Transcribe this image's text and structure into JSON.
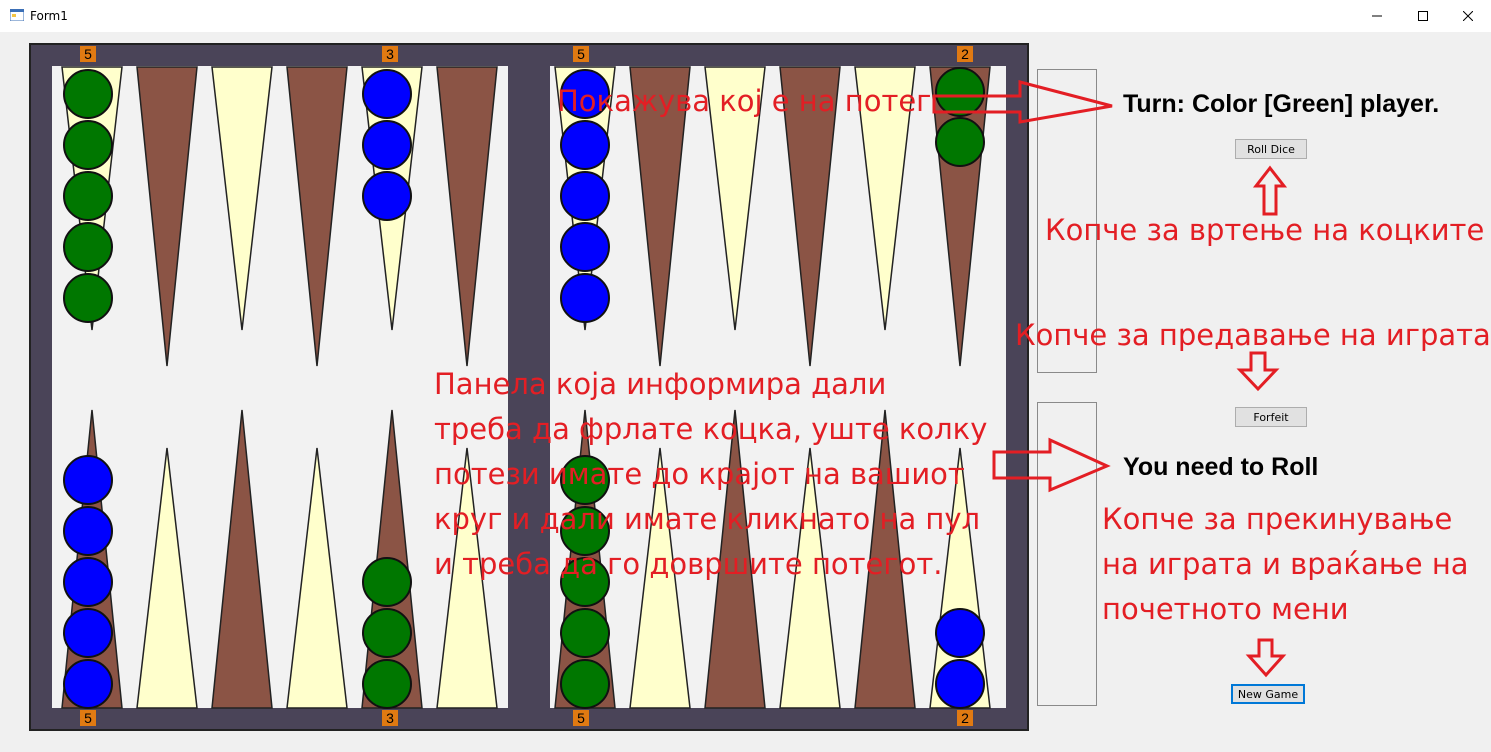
{
  "window": {
    "title": "Form1",
    "minimize_glyph": "—",
    "maximize_glyph": "☐",
    "close_glyph": "✕"
  },
  "colors": {
    "frame": "#4a4458",
    "field": "#f2f2f2",
    "point_dark": "#8b5445",
    "point_light": "#ffffcc",
    "green": "#007700",
    "blue": "#0000ff",
    "badge": "#e07a12",
    "annotation": "#e31e24"
  },
  "board": {
    "top_counts": {
      "left_edge": "5",
      "left_mid": "3",
      "right_start": "5",
      "right_edge": "2"
    },
    "bottom_counts": {
      "left_edge": "5",
      "left_mid": "3",
      "right_start": "5",
      "right_edge": "2"
    }
  },
  "status": {
    "turn": "Turn: Color [Green] player.",
    "roll_state": "You need to Roll"
  },
  "buttons": {
    "roll_dice": "Roll Dice",
    "forfeit": "Forfeit",
    "new_game": "New Game"
  },
  "annotations": {
    "turn": "Покажува кој е на потег",
    "roll": "Копче за вртење на коцките",
    "forfeit": "Копче за предавање на играта",
    "panel": [
      "Панела која информира дали",
      "треба да фрлате коцка, уште колку",
      "потези имате до крајот на вашиот",
      "круг и дали имате кликнато на пул",
      "и треба да го довршите потегот."
    ],
    "new_game": [
      "Копче за прекинување",
      "на играта и враќање на",
      "почетното мени"
    ]
  }
}
